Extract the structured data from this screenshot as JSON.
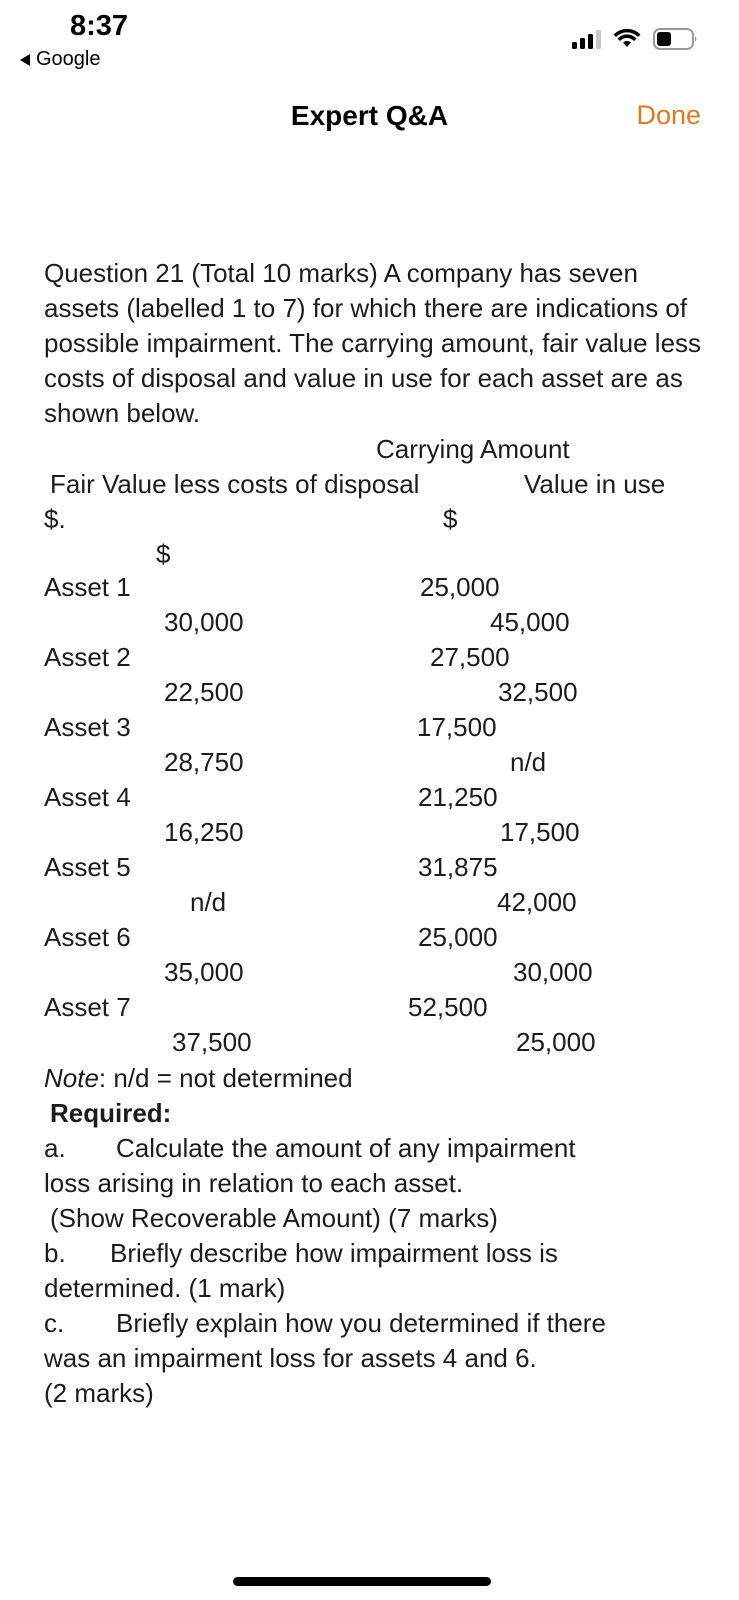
{
  "status_bar": {
    "time": "8:37",
    "back_app": "Google",
    "signal_icon": "cellular-signal-icon",
    "wifi_icon": "wifi-icon",
    "battery_icon": "battery-icon"
  },
  "nav": {
    "title": "Expert Q&A",
    "done_label": "Done",
    "done_color": "#e3791a"
  },
  "question": {
    "intro": "Question 21  (Total 10 marks) A company has seven assets (labelled 1 to 7) for which there are indications of possible impairment. The carrying amount, fair value less costs of disposal and value in use for each asset are as shown below.",
    "header_carrying": "Carrying Amount",
    "header_fair": "Fair Value less costs of disposal",
    "header_value": "Value in use",
    "currency_1": "$.",
    "currency_2": "$",
    "currency_3": "$",
    "assets": [
      {
        "label": "Asset 1",
        "carrying": "25,000",
        "fair": "30,000",
        "value_in_use": "45,000"
      },
      {
        "label": "Asset 2",
        "carrying": "27,500",
        "fair": "22,500",
        "value_in_use": "32,500"
      },
      {
        "label": "Asset 3",
        "carrying": "17,500",
        "fair": "28,750",
        "value_in_use": "n/d"
      },
      {
        "label": "Asset 4",
        "carrying": "21,250",
        "fair": "16,250",
        "value_in_use": "17,500"
      },
      {
        "label": "Asset 5",
        "carrying": "31,875",
        "fair": "n/d",
        "value_in_use": "42,000"
      },
      {
        "label": "Asset 6",
        "carrying": "25,000",
        "fair": "35,000",
        "value_in_use": "30,000"
      },
      {
        "label": "Asset 7",
        "carrying": "52,500",
        "fair": "37,500",
        "value_in_use": "25,000"
      }
    ],
    "note_label": "Note",
    "note_text": ": n/d = not determined",
    "required": "Required:",
    "req_a_letter": "a.",
    "req_a_text": "Calculate the amount of any impairment",
    "req_a_cont1": "loss arising in relation to each asset.",
    "req_a_cont2": "(Show Recoverable Amount) (7 marks)",
    "req_b_letter": "b.",
    "req_b_text": "Briefly describe how impairment loss is",
    "req_b_cont": "determined. (1 mark)",
    "req_c_letter": "c.",
    "req_c_text": "Briefly explain how you determined if there",
    "req_c_cont1": "was an impairment loss for assets 4 and 6.",
    "req_c_cont2": "(2 marks)"
  }
}
